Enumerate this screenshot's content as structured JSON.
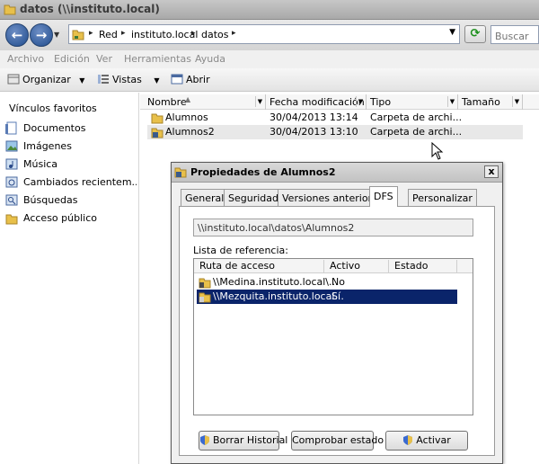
{
  "window": {
    "title": "datos (\\\\instituto.local)"
  },
  "nav": {
    "breadcrumbs": [
      "Red",
      "instituto.local",
      "datos"
    ],
    "search_placeholder": "Buscar"
  },
  "menu": [
    "Archivo",
    "Edición",
    "Ver",
    "Herramientas",
    "Ayuda"
  ],
  "toolbar": {
    "organize": "Organizar",
    "views": "Vistas",
    "open": "Abrir"
  },
  "sidebar": {
    "heading": "Vínculos favoritos",
    "items": [
      {
        "label": "Documentos",
        "icon": "documents-icon"
      },
      {
        "label": "Imágenes",
        "icon": "pictures-icon"
      },
      {
        "label": "Música",
        "icon": "music-icon"
      },
      {
        "label": "Cambiados recientem...",
        "icon": "recent-icon"
      },
      {
        "label": "Búsquedas",
        "icon": "search-icon"
      },
      {
        "label": "Acceso público",
        "icon": "folder-icon"
      }
    ]
  },
  "filelist": {
    "columns": [
      "Nombre",
      "Fecha modificación",
      "Tipo",
      "Tamaño"
    ],
    "rows": [
      {
        "name": "Alumnos",
        "date": "30/04/2013 13:14",
        "type": "Carpeta de archi..."
      },
      {
        "name": "Alumnos2",
        "date": "30/04/2013 13:10",
        "type": "Carpeta de archi..."
      }
    ]
  },
  "dialog": {
    "title": "Propiedades de Alumnos2",
    "tabs": [
      "General",
      "Seguridad",
      "Versiones anteriores",
      "DFS",
      "Personalizar"
    ],
    "path": "\\\\instituto.local\\datos\\Alumnos2",
    "ref_label": "Lista de referencia:",
    "ref_columns": [
      "Ruta de acceso",
      "Activo",
      "Estado"
    ],
    "ref_rows": [
      {
        "path": "\\\\Medina.instituto.local\\...",
        "active": "No",
        "state": ""
      },
      {
        "path": "\\\\Mezquita.instituto.local...",
        "active": "Sí",
        "state": ""
      }
    ],
    "buttons": {
      "clear_history": "Borrar Historial",
      "check_state": "Comprobar estado",
      "activate": "Activar"
    },
    "close_glyph": "x"
  }
}
